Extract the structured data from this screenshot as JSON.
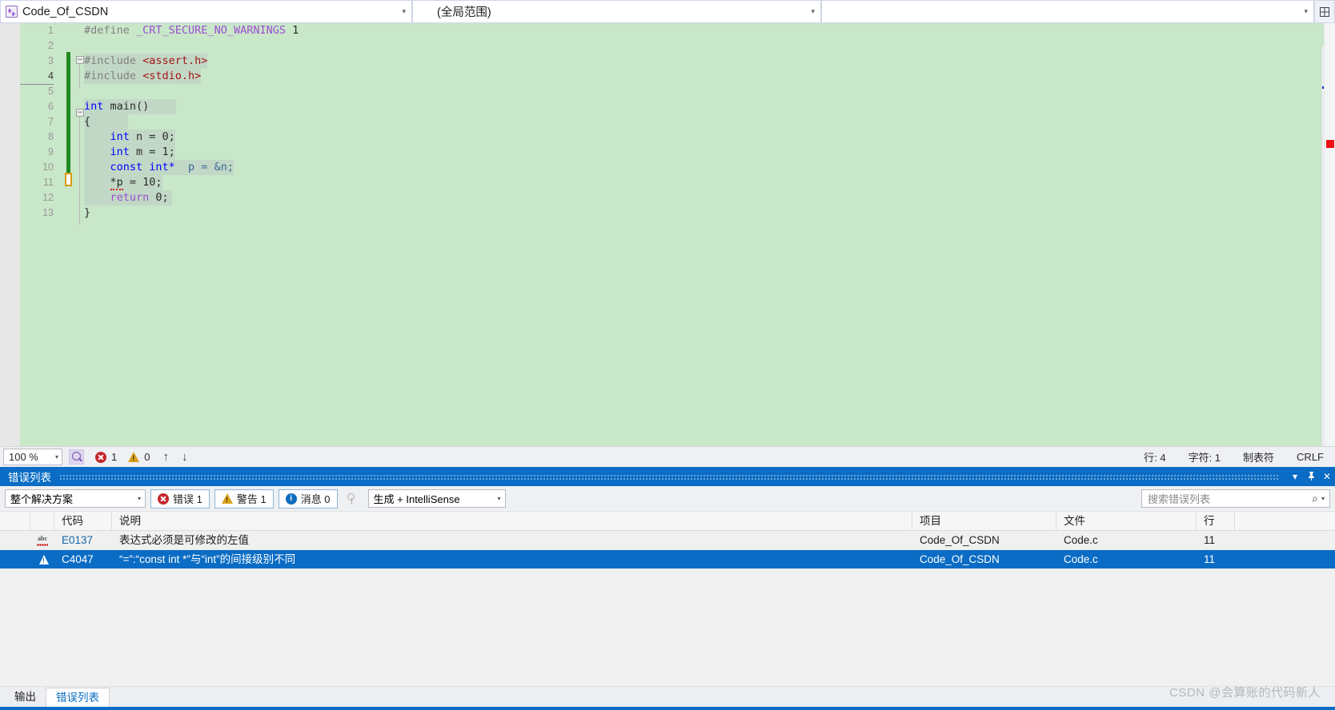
{
  "navbar": {
    "project_name": "Code_Of_CSDN",
    "scope": "(全局范围)",
    "member": "",
    "split_icon": "split-view-icon",
    "caret": "▾"
  },
  "editor": {
    "zoom": "100 %",
    "lines": [
      {
        "no": "1",
        "segments": [
          {
            "t": "#define ",
            "c": "t-gray"
          },
          {
            "t": "_CRT_SECURE_NO_WARNINGS",
            "c": "t-pp"
          },
          {
            "t": " 1",
            "c": "t-num"
          }
        ]
      },
      {
        "no": "2",
        "segments": []
      },
      {
        "no": "3",
        "segments": [
          {
            "t": "#include ",
            "c": "t-gray"
          },
          {
            "t": "<assert.h>",
            "c": "t-str"
          }
        ]
      },
      {
        "no": "4",
        "segments": [
          {
            "t": "#include ",
            "c": "t-gray"
          },
          {
            "t": "<stdio.h>",
            "c": "t-str"
          }
        ]
      },
      {
        "no": "5",
        "segments": []
      },
      {
        "no": "6",
        "segments": [
          {
            "t": "int ",
            "c": "t-kw"
          },
          {
            "t": "main()",
            "c": "t-id"
          }
        ]
      },
      {
        "no": "7",
        "segments": [
          {
            "t": "{",
            "c": "t-id"
          }
        ]
      },
      {
        "no": "8",
        "segments": [
          {
            "t": "    ",
            "c": "t-id"
          },
          {
            "t": "int ",
            "c": "t-kw"
          },
          {
            "t": "n = ",
            "c": "t-id"
          },
          {
            "t": "0;",
            "c": "t-num"
          }
        ]
      },
      {
        "no": "9",
        "segments": [
          {
            "t": "    ",
            "c": "t-id"
          },
          {
            "t": "int ",
            "c": "t-kw"
          },
          {
            "t": "m = ",
            "c": "t-id"
          },
          {
            "t": "1;",
            "c": "t-num"
          }
        ]
      },
      {
        "no": "10",
        "segments": [
          {
            "t": "    ",
            "c": "t-id"
          },
          {
            "t": "const int*",
            "c": "t-kw"
          },
          {
            "t": "  p = &n;",
            "c": "t-var"
          }
        ]
      },
      {
        "no": "11",
        "segments": [
          {
            "t": "    ",
            "c": "t-id"
          },
          {
            "t": "*p",
            "c": "t-id"
          },
          {
            "t": " = ",
            "c": "t-id"
          },
          {
            "t": "10;",
            "c": "t-num"
          }
        ]
      },
      {
        "no": "12",
        "segments": [
          {
            "t": "    ",
            "c": "t-id"
          },
          {
            "t": "return ",
            "c": "t-pp"
          },
          {
            "t": "0;",
            "c": "t-num"
          }
        ]
      },
      {
        "no": "13",
        "segments": [
          {
            "t": "}",
            "c": "t-id"
          }
        ]
      }
    ],
    "current_line": "4"
  },
  "statusbar": {
    "zoom": "100 %",
    "error_count": "1",
    "warning_count": "0",
    "nav_back": "↑",
    "nav_fwd": "↓",
    "line": "行: 4",
    "char": "字符: 1",
    "tab_mode": "制表符",
    "eol": "CRLF"
  },
  "panel": {
    "title": "错误列表",
    "buttons": {
      "dropdown": "▾",
      "pin": "📌",
      "close": "✕"
    },
    "toolbar": {
      "scope": "整个解决方案",
      "errors": "错误 1",
      "warnings": "警告 1",
      "messages": "消息 0",
      "filter_icon": "filter-icon",
      "build_source": "生成 + IntelliSense",
      "search_placeholder": "搜索错误列表",
      "caret": "▾"
    },
    "columns": [
      "",
      "",
      "代码",
      "说明",
      "项目",
      "文件",
      "行",
      ""
    ],
    "rows": [
      {
        "icon": "abc-spell-icon",
        "code": "E0137",
        "description": "表达式必须是可修改的左值",
        "project": "Code_Of_CSDN",
        "file": "Code.c",
        "line": "11",
        "selected": false
      },
      {
        "icon": "warning-icon",
        "code": "C4047",
        "description": "“=”:“const int *”与“int”的间接级别不同",
        "project": "Code_Of_CSDN",
        "file": "Code.c",
        "line": "11",
        "selected": true
      }
    ]
  },
  "bottom_tabs": [
    {
      "label": "输出",
      "active": false
    },
    {
      "label": "错误列表",
      "active": true
    }
  ],
  "watermark": "CSDN @会算账的代码新人",
  "colors": {
    "accent": "#0a6cc4",
    "editor_bg": "#c9e7c9",
    "change_bar": "#1f8b22",
    "error_red": "#c5262c",
    "warning_amber": "#d9a21b"
  }
}
